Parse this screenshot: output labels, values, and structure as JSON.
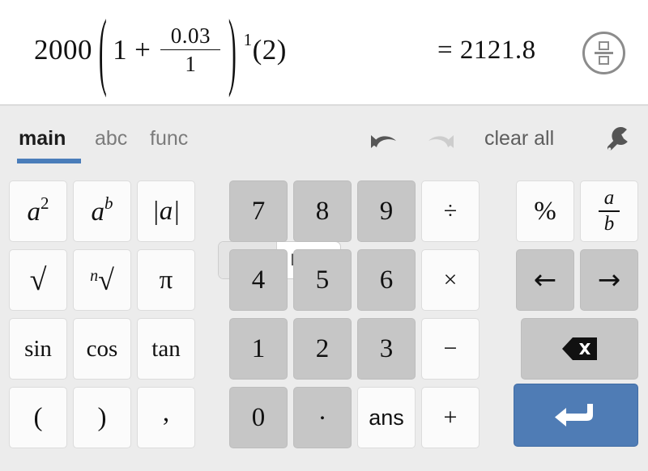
{
  "display": {
    "expression": {
      "coefficient": "2000",
      "open_paren": "(",
      "inner_first": "1",
      "operator": "+",
      "fraction_numerator": "0.03",
      "fraction_denominator": "1",
      "close_paren": ")",
      "exponent": "1",
      "trailing": "(2)",
      "full_text": "2000(1 + 0.03/1)^1(2)"
    },
    "result": "= 2121.8",
    "fraction_toggle": {
      "icon": "fraction-icon",
      "label": "toggle fraction/decimal"
    }
  },
  "toolbar": {
    "tabs": [
      {
        "id": "main",
        "label": "main",
        "active": true
      },
      {
        "id": "abc",
        "label": "abc",
        "active": false
      },
      {
        "id": "func",
        "label": "func",
        "active": false
      }
    ],
    "angle_toggle": {
      "value": "DEG",
      "state": "off"
    },
    "undo": {
      "icon": "undo-icon",
      "enabled": true
    },
    "redo": {
      "icon": "redo-icon",
      "enabled": false
    },
    "clear_all_label": "clear all",
    "settings": {
      "icon": "wrench-icon"
    }
  },
  "keypad": {
    "functions": [
      {
        "id": "square",
        "base": "a",
        "sup": "2",
        "style": "white"
      },
      {
        "id": "power",
        "base": "a",
        "sup": "b",
        "style": "white"
      },
      {
        "id": "abs",
        "label": "|a|",
        "style": "white"
      },
      {
        "id": "sqrt",
        "label": "√",
        "style": "white"
      },
      {
        "id": "nthroot",
        "label": "√",
        "index": "n",
        "style": "white"
      },
      {
        "id": "pi",
        "label": "π",
        "style": "white"
      },
      {
        "id": "sin",
        "label": "sin",
        "style": "white"
      },
      {
        "id": "cos",
        "label": "cos",
        "style": "white"
      },
      {
        "id": "tan",
        "label": "tan",
        "style": "white"
      },
      {
        "id": "open-paren",
        "label": "(",
        "style": "white"
      },
      {
        "id": "close-paren",
        "label": ")",
        "style": "white"
      },
      {
        "id": "comma",
        "label": ",",
        "style": "white"
      }
    ],
    "numbers": [
      {
        "id": "7",
        "label": "7",
        "style": "gray"
      },
      {
        "id": "8",
        "label": "8",
        "style": "gray"
      },
      {
        "id": "9",
        "label": "9",
        "style": "gray"
      },
      {
        "id": "divide",
        "label": "÷",
        "style": "white"
      },
      {
        "id": "4",
        "label": "4",
        "style": "gray"
      },
      {
        "id": "5",
        "label": "5",
        "style": "gray"
      },
      {
        "id": "6",
        "label": "6",
        "style": "gray"
      },
      {
        "id": "multiply",
        "label": "×",
        "style": "white"
      },
      {
        "id": "1",
        "label": "1",
        "style": "gray"
      },
      {
        "id": "2",
        "label": "2",
        "style": "gray"
      },
      {
        "id": "3",
        "label": "3",
        "style": "gray"
      },
      {
        "id": "minus",
        "label": "−",
        "style": "white"
      },
      {
        "id": "0",
        "label": "0",
        "style": "gray"
      },
      {
        "id": "decimal",
        "label": ".",
        "style": "gray"
      },
      {
        "id": "ans",
        "label": "ans",
        "style": "white"
      },
      {
        "id": "plus",
        "label": "+",
        "style": "white"
      }
    ],
    "right": [
      {
        "id": "percent",
        "label": "%",
        "style": "white"
      },
      {
        "id": "fraction",
        "numerator": "a",
        "denominator": "b",
        "style": "white"
      },
      {
        "id": "cursor-left",
        "label": "←",
        "style": "gray"
      },
      {
        "id": "cursor-right",
        "label": "→",
        "style": "gray"
      },
      {
        "id": "backspace",
        "icon": "backspace-icon",
        "style": "gray"
      },
      {
        "id": "enter",
        "icon": "enter-icon",
        "style": "blue"
      }
    ]
  },
  "colors": {
    "accent_blue": "#4a7dba",
    "enter_blue": "#4f7cb5",
    "key_gray": "#c6c6c6",
    "key_white": "#fbfbfb",
    "panel_bg": "#ececec"
  }
}
